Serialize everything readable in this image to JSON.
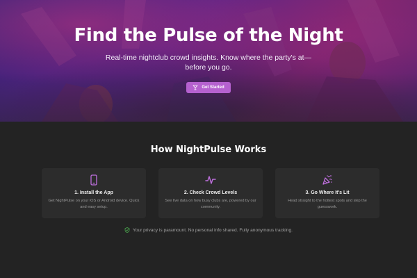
{
  "hero": {
    "title": "Find the Pulse of the Night",
    "subtitle": "Real-time nightclub crowd insights. Know where the party's at—before you go.",
    "cta_label": "Get Started",
    "cta_icon": "cocktail-icon",
    "cta_color": "#b561cf"
  },
  "how_it_works": {
    "title": "How NightPulse Works",
    "cards": [
      {
        "icon": "phone-icon",
        "title": "1. Install the App",
        "description": "Get NightPulse on your iOS or Android device. Quick and easy setup."
      },
      {
        "icon": "pulse-icon",
        "title": "2. Check Crowd Levels",
        "description": "See live data on how busy clubs are, powered by our community."
      },
      {
        "icon": "party-popper-icon",
        "title": "3. Go Where It's Lit",
        "description": "Head straight to the hottest spots and skip the guesswork."
      }
    ]
  },
  "privacy": {
    "icon": "shield-check-icon",
    "text": "Your privacy is paramount. No personal info shared. Fully anonymous tracking.",
    "icon_color": "#4caf50"
  },
  "colors": {
    "accent": "#b561cf",
    "background": "#232323",
    "card": "#2c2c2c"
  }
}
